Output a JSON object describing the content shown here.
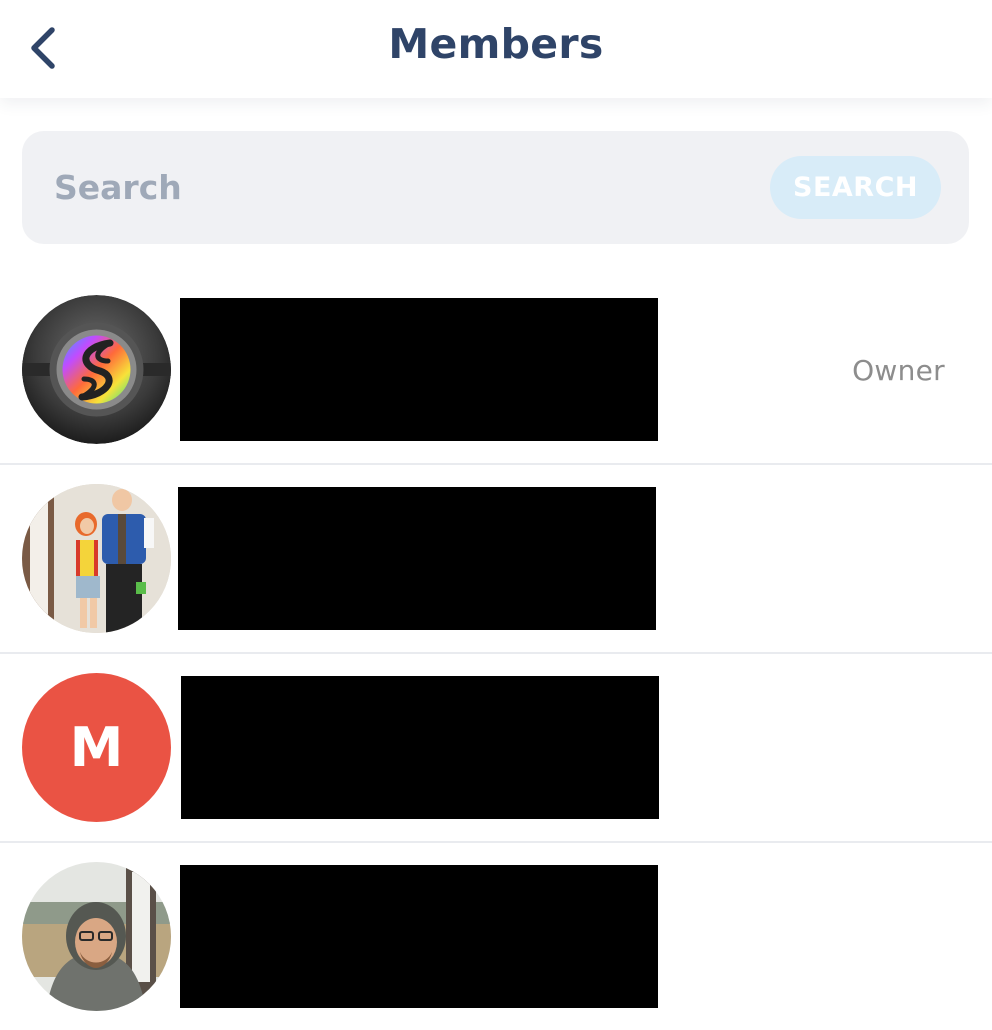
{
  "header": {
    "title": "Members",
    "back_icon": "chevron-left-icon",
    "title_color": "#2f4468"
  },
  "search": {
    "placeholder": "Search",
    "value": "",
    "button_label": "SEARCH",
    "button_color": "#d8ecf8"
  },
  "members": [
    {
      "role": "Owner",
      "avatar": "mega-stone-logo",
      "name_redacted": true
    },
    {
      "role": "",
      "avatar": "photo-costume-couple",
      "name_redacted": true
    },
    {
      "role": "",
      "avatar": "letter",
      "avatar_letter": "M",
      "avatar_color": "#ea5344",
      "name_redacted": true
    },
    {
      "role": "",
      "avatar": "photo-man-hoodie",
      "name_redacted": true
    }
  ]
}
